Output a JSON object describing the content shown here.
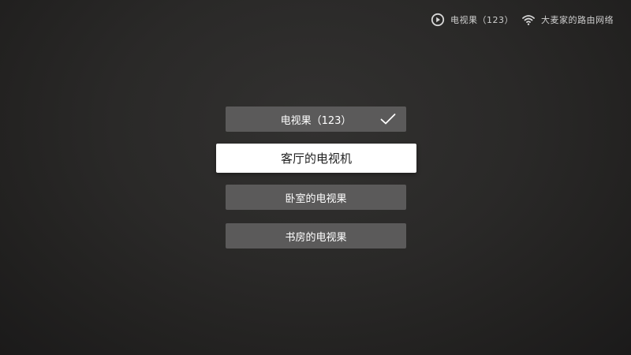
{
  "status_bar": {
    "device_icon": "play-circle-icon",
    "device_label": "电视果（123）",
    "wifi_icon": "wifi-icon",
    "wifi_label": "大麦家的路由网络"
  },
  "device_menu": {
    "items": [
      {
        "label": "电视果（123）",
        "selected": true,
        "check_icon": "check-icon"
      },
      {
        "label": "客厅的电视机",
        "focused": true
      },
      {
        "label": "卧室的电视果"
      },
      {
        "label": "书房的电视果"
      }
    ]
  },
  "colors": {
    "background": "#2a2928",
    "item_background": "#5b5a5a",
    "focused_background": "#ffffff",
    "focused_text": "#1f1f1f"
  }
}
